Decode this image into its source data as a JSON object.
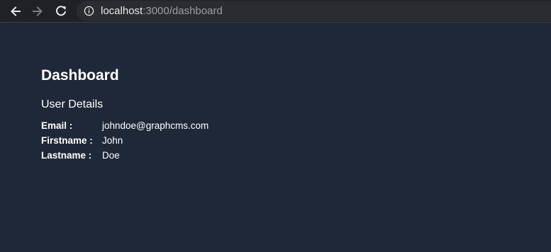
{
  "browser": {
    "back_icon": "arrow-left-icon",
    "forward_icon": "arrow-right-icon",
    "reload_icon": "reload-icon",
    "info_icon": "info-icon",
    "url_host": "localhost",
    "url_rest": ":3000/dashboard"
  },
  "page": {
    "title": "Dashboard",
    "section_title": "User Details",
    "details": [
      {
        "label": "Email :",
        "value": "johndoe@graphcms.com"
      },
      {
        "label": "Firstname :",
        "value": "John"
      },
      {
        "label": "Lastname :",
        "value": "Doe"
      }
    ]
  },
  "colors": {
    "page_background": "#1f2838",
    "browser_bar": "#202124",
    "omnibox": "#2b2c2f",
    "text": "#ffffff",
    "url_muted": "#9aa0a6"
  }
}
